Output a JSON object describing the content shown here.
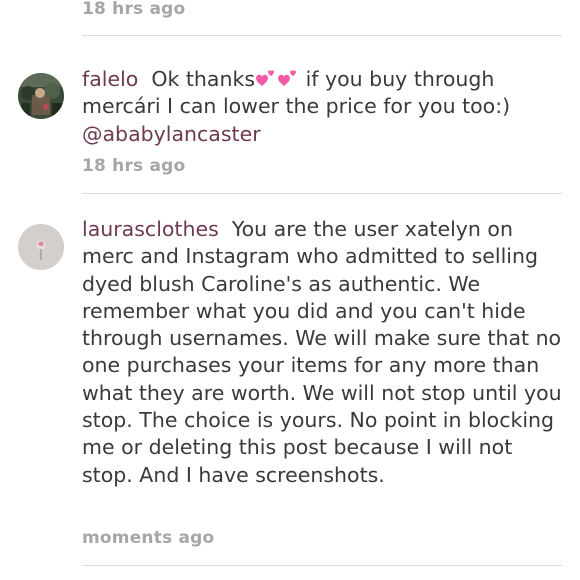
{
  "comments": [
    {
      "timestamp": "18 hrs ago"
    },
    {
      "username": "falelo",
      "text_part1": "Ok thanks",
      "emoji": "two-hearts-icon",
      "text_part2": " if you buy through mercári I can lower the price for you too:) ",
      "mention": "@ababylancaster",
      "timestamp": "18 hrs ago"
    },
    {
      "username": "laurasclothes",
      "text": "You are the user xatelyn on merc and Instagram who admitted to selling dyed blush Caroline's as authentic. We remember what you did and you can't hide through usernames. We will make sure that no one purchases your items for any more than what they are worth. We will not stop until you stop. The choice is yours. No point in blocking me or deleting this post because I will not stop. And I have screenshots.",
      "timestamp": "moments ago"
    }
  ],
  "colors": {
    "username": "#6d3a52",
    "timestamp": "#a6a6a6",
    "body_text": "#3a3a3a",
    "divider": "#dcdcdc",
    "emoji_pink": "#f25ba8"
  }
}
